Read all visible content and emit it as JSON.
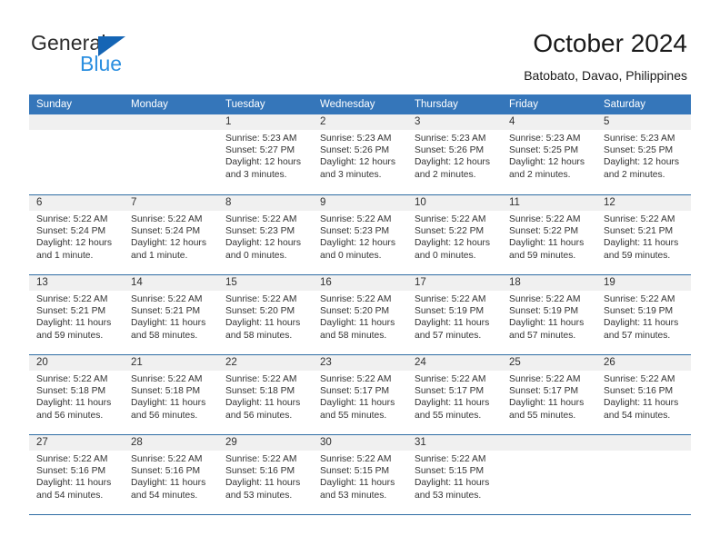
{
  "brand": {
    "name_part1": "General",
    "name_part2": "Blue",
    "triangle_color": "#1565b5",
    "blue_text_color": "#2b8fe0"
  },
  "header": {
    "title": "October 2024",
    "subtitle": "Batobato, Davao, Philippines",
    "header_bg_color": "#3576ba",
    "row_rule_color": "#2e6da4",
    "daynum_band_color": "#f0f0f0"
  },
  "calendar": {
    "weekday_headers": [
      "Sunday",
      "Monday",
      "Tuesday",
      "Wednesday",
      "Thursday",
      "Friday",
      "Saturday"
    ],
    "weeks": [
      [
        {
          "day": "",
          "lines": []
        },
        {
          "day": "",
          "lines": []
        },
        {
          "day": "1",
          "lines": [
            "Sunrise: 5:23 AM",
            "Sunset: 5:27 PM",
            "Daylight: 12 hours",
            "and 3 minutes."
          ]
        },
        {
          "day": "2",
          "lines": [
            "Sunrise: 5:23 AM",
            "Sunset: 5:26 PM",
            "Daylight: 12 hours",
            "and 3 minutes."
          ]
        },
        {
          "day": "3",
          "lines": [
            "Sunrise: 5:23 AM",
            "Sunset: 5:26 PM",
            "Daylight: 12 hours",
            "and 2 minutes."
          ]
        },
        {
          "day": "4",
          "lines": [
            "Sunrise: 5:23 AM",
            "Sunset: 5:25 PM",
            "Daylight: 12 hours",
            "and 2 minutes."
          ]
        },
        {
          "day": "5",
          "lines": [
            "Sunrise: 5:23 AM",
            "Sunset: 5:25 PM",
            "Daylight: 12 hours",
            "and 2 minutes."
          ]
        }
      ],
      [
        {
          "day": "6",
          "lines": [
            "Sunrise: 5:22 AM",
            "Sunset: 5:24 PM",
            "Daylight: 12 hours",
            "and 1 minute."
          ]
        },
        {
          "day": "7",
          "lines": [
            "Sunrise: 5:22 AM",
            "Sunset: 5:24 PM",
            "Daylight: 12 hours",
            "and 1 minute."
          ]
        },
        {
          "day": "8",
          "lines": [
            "Sunrise: 5:22 AM",
            "Sunset: 5:23 PM",
            "Daylight: 12 hours",
            "and 0 minutes."
          ]
        },
        {
          "day": "9",
          "lines": [
            "Sunrise: 5:22 AM",
            "Sunset: 5:23 PM",
            "Daylight: 12 hours",
            "and 0 minutes."
          ]
        },
        {
          "day": "10",
          "lines": [
            "Sunrise: 5:22 AM",
            "Sunset: 5:22 PM",
            "Daylight: 12 hours",
            "and 0 minutes."
          ]
        },
        {
          "day": "11",
          "lines": [
            "Sunrise: 5:22 AM",
            "Sunset: 5:22 PM",
            "Daylight: 11 hours",
            "and 59 minutes."
          ]
        },
        {
          "day": "12",
          "lines": [
            "Sunrise: 5:22 AM",
            "Sunset: 5:21 PM",
            "Daylight: 11 hours",
            "and 59 minutes."
          ]
        }
      ],
      [
        {
          "day": "13",
          "lines": [
            "Sunrise: 5:22 AM",
            "Sunset: 5:21 PM",
            "Daylight: 11 hours",
            "and 59 minutes."
          ]
        },
        {
          "day": "14",
          "lines": [
            "Sunrise: 5:22 AM",
            "Sunset: 5:21 PM",
            "Daylight: 11 hours",
            "and 58 minutes."
          ]
        },
        {
          "day": "15",
          "lines": [
            "Sunrise: 5:22 AM",
            "Sunset: 5:20 PM",
            "Daylight: 11 hours",
            "and 58 minutes."
          ]
        },
        {
          "day": "16",
          "lines": [
            "Sunrise: 5:22 AM",
            "Sunset: 5:20 PM",
            "Daylight: 11 hours",
            "and 58 minutes."
          ]
        },
        {
          "day": "17",
          "lines": [
            "Sunrise: 5:22 AM",
            "Sunset: 5:19 PM",
            "Daylight: 11 hours",
            "and 57 minutes."
          ]
        },
        {
          "day": "18",
          "lines": [
            "Sunrise: 5:22 AM",
            "Sunset: 5:19 PM",
            "Daylight: 11 hours",
            "and 57 minutes."
          ]
        },
        {
          "day": "19",
          "lines": [
            "Sunrise: 5:22 AM",
            "Sunset: 5:19 PM",
            "Daylight: 11 hours",
            "and 57 minutes."
          ]
        }
      ],
      [
        {
          "day": "20",
          "lines": [
            "Sunrise: 5:22 AM",
            "Sunset: 5:18 PM",
            "Daylight: 11 hours",
            "and 56 minutes."
          ]
        },
        {
          "day": "21",
          "lines": [
            "Sunrise: 5:22 AM",
            "Sunset: 5:18 PM",
            "Daylight: 11 hours",
            "and 56 minutes."
          ]
        },
        {
          "day": "22",
          "lines": [
            "Sunrise: 5:22 AM",
            "Sunset: 5:18 PM",
            "Daylight: 11 hours",
            "and 56 minutes."
          ]
        },
        {
          "day": "23",
          "lines": [
            "Sunrise: 5:22 AM",
            "Sunset: 5:17 PM",
            "Daylight: 11 hours",
            "and 55 minutes."
          ]
        },
        {
          "day": "24",
          "lines": [
            "Sunrise: 5:22 AM",
            "Sunset: 5:17 PM",
            "Daylight: 11 hours",
            "and 55 minutes."
          ]
        },
        {
          "day": "25",
          "lines": [
            "Sunrise: 5:22 AM",
            "Sunset: 5:17 PM",
            "Daylight: 11 hours",
            "and 55 minutes."
          ]
        },
        {
          "day": "26",
          "lines": [
            "Sunrise: 5:22 AM",
            "Sunset: 5:16 PM",
            "Daylight: 11 hours",
            "and 54 minutes."
          ]
        }
      ],
      [
        {
          "day": "27",
          "lines": [
            "Sunrise: 5:22 AM",
            "Sunset: 5:16 PM",
            "Daylight: 11 hours",
            "and 54 minutes."
          ]
        },
        {
          "day": "28",
          "lines": [
            "Sunrise: 5:22 AM",
            "Sunset: 5:16 PM",
            "Daylight: 11 hours",
            "and 54 minutes."
          ]
        },
        {
          "day": "29",
          "lines": [
            "Sunrise: 5:22 AM",
            "Sunset: 5:16 PM",
            "Daylight: 11 hours",
            "and 53 minutes."
          ]
        },
        {
          "day": "30",
          "lines": [
            "Sunrise: 5:22 AM",
            "Sunset: 5:15 PM",
            "Daylight: 11 hours",
            "and 53 minutes."
          ]
        },
        {
          "day": "31",
          "lines": [
            "Sunrise: 5:22 AM",
            "Sunset: 5:15 PM",
            "Daylight: 11 hours",
            "and 53 minutes."
          ]
        },
        {
          "day": "",
          "lines": []
        },
        {
          "day": "",
          "lines": []
        }
      ]
    ]
  }
}
